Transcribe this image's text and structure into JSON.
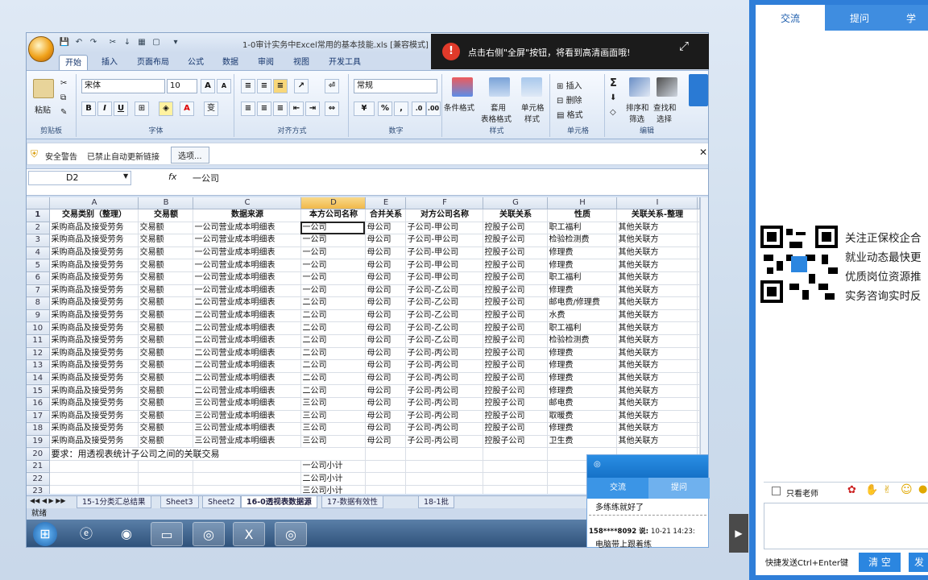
{
  "window": {
    "title": "1-0审计实务中Excel常用的基本技能.xls [兼容模式]",
    "ribbon_tabs": [
      "开始",
      "插入",
      "页面布局",
      "公式",
      "数据",
      "审阅",
      "视图",
      "开发工具"
    ],
    "active_tab": 0
  },
  "ribbon": {
    "clipboard": {
      "paste": "粘贴",
      "label": "剪贴板"
    },
    "font": {
      "name": "宋体",
      "size": "10",
      "bold": "B",
      "italic": "I",
      "underline": "U",
      "label": "字体",
      "grow": "A",
      "shrink": "A",
      "color_a": "A",
      "phonetic": "变"
    },
    "alignment": {
      "label": "对齐方式"
    },
    "number": {
      "format": "常规",
      "percent": "%",
      "comma": ",",
      "label": "数字"
    },
    "styles": {
      "conditional_1": "条件格式",
      "table_1": "套用",
      "table_2": "表格格式",
      "cell_1": "单元格",
      "cell_2": "样式",
      "label": "样式"
    },
    "cells": {
      "insert": "插入",
      "delete": "删除",
      "format": "格式",
      "label": "单元格"
    },
    "editing": {
      "sigma": "Σ",
      "sort_1": "排序和",
      "sort_2": "筛选",
      "find_1": "查找和",
      "find_2": "选择",
      "label": "编辑"
    }
  },
  "notice": {
    "text": "点击右侧\"全屏\"按钮，将看到高清画面哦!"
  },
  "security": {
    "label": "安全警告",
    "message": "已禁止自动更新链接",
    "options_button": "选项..."
  },
  "formula_bar": {
    "name_box": "D2",
    "fx": "fx",
    "value": "一公司"
  },
  "spreadsheet": {
    "columns": [
      "A",
      "B",
      "C",
      "D",
      "E",
      "F",
      "G",
      "H",
      "I"
    ],
    "selected_column": "D",
    "headers": [
      "交易类别（整理）",
      "交易额",
      "数据来源",
      "本方公司名称",
      "合并关系",
      "对方公司名称",
      "关联关系",
      "性质",
      "关联关系-整理"
    ],
    "rows": [
      [
        "采购商品及接受劳务",
        "交易额",
        "一公司营业成本明细表",
        "一公司",
        "母公司",
        "子公司-甲公司",
        "控股子公司",
        "职工福利",
        "其他关联方"
      ],
      [
        "采购商品及接受劳务",
        "交易额",
        "一公司营业成本明细表",
        "一公司",
        "母公司",
        "子公司-甲公司",
        "控股子公司",
        "检验检测费",
        "其他关联方"
      ],
      [
        "采购商品及接受劳务",
        "交易额",
        "一公司营业成本明细表",
        "一公司",
        "母公司",
        "子公司-甲公司",
        "控股子公司",
        "修理费",
        "其他关联方"
      ],
      [
        "采购商品及接受劳务",
        "交易额",
        "一公司营业成本明细表",
        "一公司",
        "母公司",
        "子公司-甲公司",
        "控股子公司",
        "修理费",
        "其他关联方"
      ],
      [
        "采购商品及接受劳务",
        "交易额",
        "一公司营业成本明细表",
        "一公司",
        "母公司",
        "子公司-甲公司",
        "控股子公司",
        "职工福利",
        "其他关联方"
      ],
      [
        "采购商品及接受劳务",
        "交易额",
        "一公司营业成本明细表",
        "一公司",
        "母公司",
        "子公司-乙公司",
        "控股子公司",
        "修理费",
        "其他关联方"
      ],
      [
        "采购商品及接受劳务",
        "交易额",
        "二公司营业成本明细表",
        "二公司",
        "母公司",
        "子公司-乙公司",
        "控股子公司",
        "邮电费/修理费",
        "其他关联方"
      ],
      [
        "采购商品及接受劳务",
        "交易额",
        "二公司营业成本明细表",
        "二公司",
        "母公司",
        "子公司-乙公司",
        "控股子公司",
        "水费",
        "其他关联方"
      ],
      [
        "采购商品及接受劳务",
        "交易额",
        "二公司营业成本明细表",
        "二公司",
        "母公司",
        "子公司-乙公司",
        "控股子公司",
        "职工福利",
        "其他关联方"
      ],
      [
        "采购商品及接受劳务",
        "交易额",
        "二公司营业成本明细表",
        "二公司",
        "母公司",
        "子公司-乙公司",
        "控股子公司",
        "检验检测费",
        "其他关联方"
      ],
      [
        "采购商品及接受劳务",
        "交易额",
        "二公司营业成本明细表",
        "二公司",
        "母公司",
        "子公司-丙公司",
        "控股子公司",
        "修理费",
        "其他关联方"
      ],
      [
        "采购商品及接受劳务",
        "交易额",
        "二公司营业成本明细表",
        "二公司",
        "母公司",
        "子公司-丙公司",
        "控股子公司",
        "修理费",
        "其他关联方"
      ],
      [
        "采购商品及接受劳务",
        "交易额",
        "二公司营业成本明细表",
        "二公司",
        "母公司",
        "子公司-丙公司",
        "控股子公司",
        "修理费",
        "其他关联方"
      ],
      [
        "采购商品及接受劳务",
        "交易额",
        "二公司营业成本明细表",
        "二公司",
        "母公司",
        "子公司-丙公司",
        "控股子公司",
        "修理费",
        "其他关联方"
      ],
      [
        "采购商品及接受劳务",
        "交易额",
        "三公司营业成本明细表",
        "三公司",
        "母公司",
        "子公司-丙公司",
        "控股子公司",
        "邮电费",
        "其他关联方"
      ],
      [
        "采购商品及接受劳务",
        "交易额",
        "三公司营业成本明细表",
        "三公司",
        "母公司",
        "子公司-丙公司",
        "控股子公司",
        "取暖费",
        "其他关联方"
      ],
      [
        "采购商品及接受劳务",
        "交易额",
        "三公司营业成本明细表",
        "三公司",
        "母公司",
        "子公司-丙公司",
        "控股子公司",
        "修理费",
        "其他关联方"
      ],
      [
        "采购商品及接受劳务",
        "交易额",
        "三公司营业成本明细表",
        "三公司",
        "母公司",
        "子公司-丙公司",
        "控股子公司",
        "卫生费",
        "其他关联方"
      ]
    ],
    "row20_text": "要求：用透视表统计子公司之间的关联交易",
    "row21_d": "一公司小计",
    "row22_d": "二公司小计",
    "row23_d": "三公司小计",
    "row_numbers": [
      "1",
      "2",
      "3",
      "4",
      "5",
      "6",
      "7",
      "8",
      "9",
      "10",
      "11",
      "12",
      "13",
      "14",
      "15",
      "16",
      "17",
      "18",
      "19",
      "20",
      "21",
      "22",
      "23"
    ]
  },
  "sheet_tabs": [
    "15-1分类汇总结果",
    "Sheet3",
    "Sheet2",
    "16-0透视表数据源",
    "17-数据有效性",
    "18-1批"
  ],
  "active_sheet": 3,
  "statusbar": {
    "text": "就绪"
  },
  "chat_small": {
    "tabs": [
      "交流",
      "提问"
    ],
    "message": "多练练就好了",
    "user": "158****8092",
    "said": "说:",
    "time": "10-21 14:23:",
    "message2": "电脑带上跟着练"
  },
  "side_panel": {
    "tabs": [
      "交流",
      "提问",
      "学"
    ],
    "promo_lines": [
      "关注正保校企合",
      "就业动态最快更",
      "优质岗位资源推",
      "实务咨询实时反"
    ],
    "only_teacher": "只看老师",
    "shortcut": "快捷发送Ctrl+Enter键",
    "clear_button": "清 空",
    "send_button": "发"
  },
  "colors": {
    "ribbon_blue": "#dbe6f4",
    "chat_blue": "#2f7ed8",
    "notice_bg": "#1b1b1b"
  }
}
